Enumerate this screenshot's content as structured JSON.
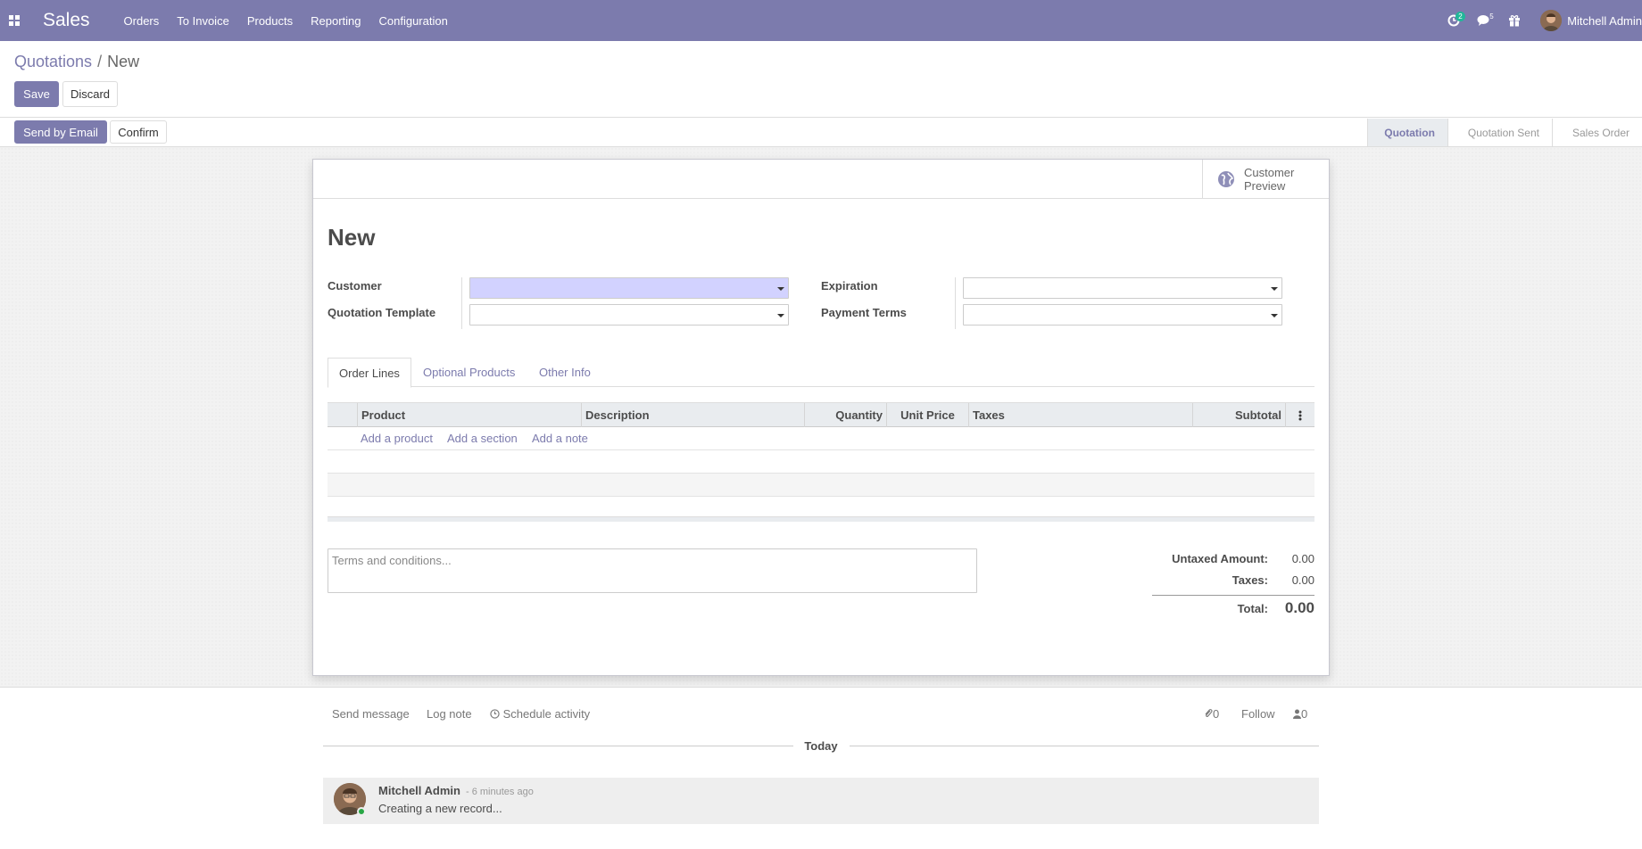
{
  "navbar": {
    "app_name": "Sales",
    "menu": [
      "Orders",
      "To Invoice",
      "Products",
      "Reporting",
      "Configuration"
    ],
    "activity_count": "2",
    "message_count": "5",
    "user_name": "Mitchell Admin",
    "accent_color": "#7c7bad"
  },
  "breadcrumb": {
    "parent": "Quotations",
    "separator": "/",
    "current": "New"
  },
  "control_panel": {
    "save_label": "Save",
    "discard_label": "Discard"
  },
  "statusbar": {
    "send_email_label": "Send by Email",
    "confirm_label": "Confirm",
    "stages": [
      "Quotation",
      "Quotation Sent",
      "Sales Order"
    ],
    "active_stage": "Quotation"
  },
  "sheet": {
    "preview_label_1": "Customer",
    "preview_label_2": "Preview",
    "title": "New",
    "fields": {
      "customer": {
        "label": "Customer",
        "value": ""
      },
      "quotation_template": {
        "label": "Quotation Template",
        "value": ""
      },
      "expiration": {
        "label": "Expiration",
        "value": ""
      },
      "payment_terms": {
        "label": "Payment Terms",
        "value": ""
      }
    },
    "tabs": [
      "Order Lines",
      "Optional Products",
      "Other Info"
    ],
    "active_tab": "Order Lines",
    "table": {
      "columns": [
        "Product",
        "Description",
        "Quantity",
        "Unit Price",
        "Taxes",
        "Subtotal"
      ],
      "add_links": [
        "Add a product",
        "Add a section",
        "Add a note"
      ]
    },
    "terms_placeholder": "Terms and conditions...",
    "totals": {
      "untaxed_label": "Untaxed Amount:",
      "untaxed_value": "0.00",
      "taxes_label": "Taxes:",
      "taxes_value": "0.00",
      "total_label": "Total:",
      "total_value": "0.00"
    }
  },
  "chatter": {
    "send_message": "Send message",
    "log_note": "Log note",
    "schedule_activity": "Schedule activity",
    "attachments_count": "0",
    "follow": "Follow",
    "followers_count": "0",
    "date_separator": "Today",
    "messages": [
      {
        "author": "Mitchell Admin",
        "date": "- 6 minutes ago",
        "body": "Creating a new record..."
      }
    ]
  }
}
